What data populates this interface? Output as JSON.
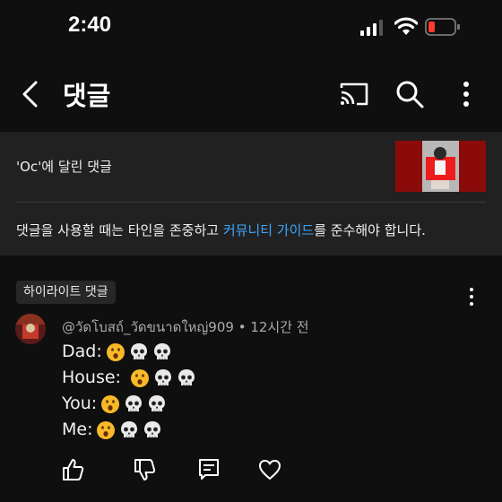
{
  "status": {
    "time": "2:40"
  },
  "header": {
    "title": "댓글"
  },
  "video": {
    "reference": "'Oc'에 달린 댓글",
    "guideline_prefix": "댓글을 사용할 때는 타인을 존중하고 ",
    "guideline_link": "커뮤니티 가이드",
    "guideline_suffix": "를 준수해야 합니다."
  },
  "comments_section": {
    "highlight_label": "하이라이트 댓글"
  },
  "comment": {
    "author": "@วัดโบสถ์_วัดขนาดใหญ่909",
    "separator": " • ",
    "time": "12시간 전",
    "lines": [
      {
        "text": "Dad:"
      },
      {
        "text": "House: "
      },
      {
        "text": "You:"
      },
      {
        "text": "Me:"
      }
    ]
  },
  "colors": {
    "background": "#0f0f0f",
    "panel": "#212121",
    "link": "#3ea6ff",
    "battery_low": "#ff3b30"
  },
  "icons": [
    "back-arrow-icon",
    "cast-icon",
    "search-icon",
    "more-vert-icon",
    "like-icon",
    "dislike-icon",
    "reply-icon",
    "heart-icon"
  ]
}
